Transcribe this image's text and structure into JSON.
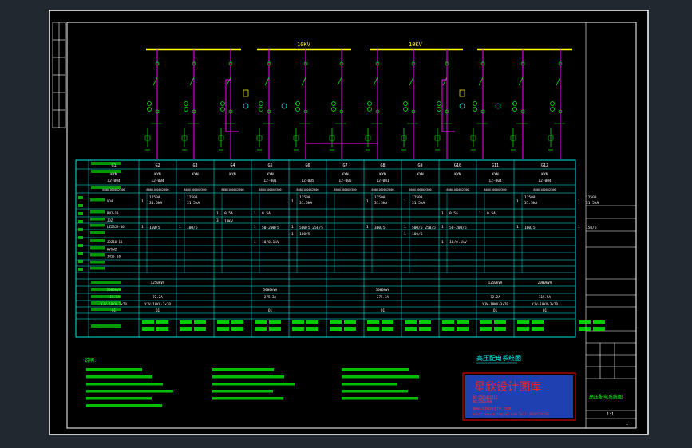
{
  "bus_labels": [
    "10KV",
    "10KV"
  ],
  "panel_numbers": [
    "G1",
    "G2",
    "G3",
    "G4",
    "G5",
    "G6",
    "G7",
    "G8",
    "G9",
    "G10",
    "G11",
    "G12"
  ],
  "panel_models": [
    "KYN",
    "KYN",
    "KYN",
    "KYN",
    "KYN",
    "",
    "KYN",
    "KYN",
    "KYN",
    "KYN",
    "KYN",
    "KYN"
  ],
  "panel_codes": [
    "12-004",
    "12-004",
    "",
    "",
    "12-001",
    "12-005",
    "12-005",
    "12-001",
    "",
    "",
    "12-004",
    "12-004"
  ],
  "dimensions_row": [
    "800X1600X2300",
    "800X1600X2300",
    "800X1600X2300",
    "800X1600X2300",
    "800X1600X2300",
    "800X1600X2300",
    "800X1600X2300",
    "800X1600X2300",
    "800X1600X2300",
    "800X1600X2300",
    "800X1600X2300",
    "800X1600X2300"
  ],
  "breaker_rows": [
    {
      "prefix": "VD4",
      "cells": [
        "1250A\n31.5kA",
        "1250A\n31.5kA",
        "",
        "",
        "1250A\n31.5kA",
        "",
        "1250A\n31.5kA",
        "1250A\n31.5kA",
        "",
        "",
        "1250A\n31.5kA",
        "1250A\n31.5kA"
      ]
    },
    {
      "prefix": "RN2-10",
      "cells": [
        "",
        "",
        "0.5A",
        "0.5A",
        "",
        "",
        "",
        "",
        "0.5A",
        "0.5A",
        "",
        ""
      ]
    },
    {
      "prefix": "JDZ",
      "cells": [
        "",
        "",
        "10KV",
        "",
        "",
        "",
        "",
        "",
        "",
        "",
        "",
        ""
      ]
    },
    {
      "prefix": "LZZBJ9-10",
      "cells": [
        "150/5",
        "100/5",
        "",
        "50-200/5",
        "500/5 250/5",
        "",
        "300/5",
        "500/5 250/5",
        "50-200/5",
        "",
        "100/5",
        "150/5"
      ]
    },
    {
      "prefix": "",
      "cells": [
        "",
        "",
        "",
        "",
        "100/5",
        "",
        "",
        "100/5",
        "",
        "",
        "",
        ""
      ]
    },
    {
      "prefix": "JDZ10-10",
      "cells": [
        "",
        "",
        "",
        "10/0.1kV",
        "",
        "",
        "",
        "",
        "10/0.1kV",
        "",
        "",
        ""
      ]
    },
    {
      "prefix": "HY5WZ",
      "cells": [
        "",
        "",
        "",
        "",
        "",
        "",
        "",
        "",
        "",
        "",
        "",
        ""
      ]
    },
    {
      "prefix": "JN15-10",
      "cells": [
        "",
        "",
        "",
        "",
        "",
        "",
        "",
        "",
        "",
        "",
        "",
        ""
      ]
    },
    {
      "prefix": "",
      "cells": [
        "",
        "",
        "",
        "",
        "",
        "",
        "",
        "",
        "",
        "",
        "",
        ""
      ]
    }
  ],
  "load_rows": [
    [
      "",
      "1250kVA",
      "",
      "",
      "",
      "",
      "",
      "",
      "",
      "",
      "1250kVA",
      "2000kVA"
    ],
    [
      "2000kVA",
      "",
      "",
      "",
      "5000kVA",
      "",
      "",
      "5000kVA",
      "",
      "",
      "",
      ""
    ],
    [
      "115.5A",
      "72.2A",
      "",
      "",
      "275.3A",
      "",
      "",
      "275.3A",
      "",
      "",
      "72.2A",
      "115.5A"
    ],
    [
      "YJV-10KV-3x70",
      "YJV-10KV-3x70",
      "",
      "",
      "",
      "",
      "",
      "",
      "",
      "",
      "YJV-10KV-3x70",
      "YJV-10KV-3x70"
    ],
    [
      "Q1",
      "Q1",
      "",
      "",
      "Q1",
      "",
      "",
      "Q1",
      "",
      "",
      "Q1",
      "Q1"
    ]
  ],
  "drawing_title": "高压配电系统图",
  "notes_heading": "说明:",
  "watermark": {
    "title": "星欣设计图库",
    "lines": [
      "QQ:2565461515",
      "QQ:5566788"
    ],
    "web": "www.xinxsjtk.com",
    "mail": "Email:xinxsjtk@163.com Tel:13818154320"
  },
  "title_block": {
    "project_name": "高压配电系统图",
    "drawing_no": "1:1",
    "sheet": "1"
  },
  "colors": {
    "background": "#212830",
    "frame": "#ffffff",
    "bus": "#ffff00",
    "circuit": "#00ff00",
    "feeder": "#ff00ff",
    "grid": "#00ffff",
    "watermark_border": "#ff0000",
    "watermark_text": "#ff0000",
    "watermark_bg": "#1e40b0"
  }
}
